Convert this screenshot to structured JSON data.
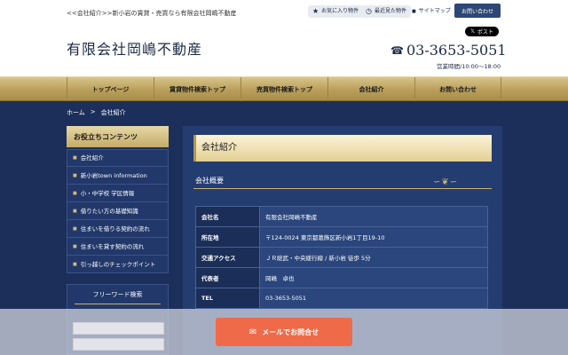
{
  "header": {
    "tagline": "<<会社紹介>>新小岩の賃貸・売買なら有限会社岡嶋不動産",
    "site_title": "有限会社岡嶋不動産",
    "favorites_label": "お気に入り物件",
    "recent_label": "最近見た物件",
    "sitemap_label": "サイトマップ",
    "contact_label": "お問い合わせ",
    "x_post_label": "ポスト",
    "phone": "03-3653-5051",
    "hours": "営業時間/10:00〜18:00"
  },
  "nav": [
    {
      "label": "トップページ"
    },
    {
      "label": "賃貸物件検索トップ"
    },
    {
      "label": "売買物件検索トップ"
    },
    {
      "label": "会社紹介"
    },
    {
      "label": "お問い合わせ"
    }
  ],
  "breadcrumb": {
    "home": "ホーム",
    "sep": ">",
    "current": "会社紹介"
  },
  "sidebar": {
    "heading": "お役立ちコンテンツ",
    "items": [
      {
        "label": "会社紹介"
      },
      {
        "label": "新小岩town information"
      },
      {
        "label": "小・中学校 学区情報"
      },
      {
        "label": "借りたい方の基礎知識"
      },
      {
        "label": "住まいを借りる契約の流れ"
      },
      {
        "label": "住まいを貸す契約の流れ"
      },
      {
        "label": "引っ越しのチェックポイント"
      }
    ],
    "search_heading": "フリーワード検索"
  },
  "main": {
    "title": "会社紹介",
    "section": "会社概要",
    "rows": [
      {
        "k": "会社名",
        "v": "有限会社岡嶋不動産"
      },
      {
        "k": "所在地",
        "v": "〒124-0024 東京都葛飾区新小岩1丁目19-10"
      },
      {
        "k": "交通アクセス",
        "v": "ＪＲ総武・中央緩行線 / 新小岩 徒歩 5分"
      },
      {
        "k": "代表者",
        "v": "岡嶋　卓也"
      },
      {
        "k": "TEL",
        "v": "03-3653-5051"
      }
    ]
  },
  "mail_button": {
    "label": "メールでお問合せ"
  },
  "colors": {
    "navy": "#1c2f5a",
    "gold": "#c9b274",
    "mail_button": "#ee6a48"
  },
  "icons": {
    "favorites": "star-icon",
    "recent": "clock-icon",
    "sitemap": "square-bullet-icon",
    "phone": "phone-icon",
    "mail": "envelope-icon",
    "x": "x-logo-icon"
  }
}
